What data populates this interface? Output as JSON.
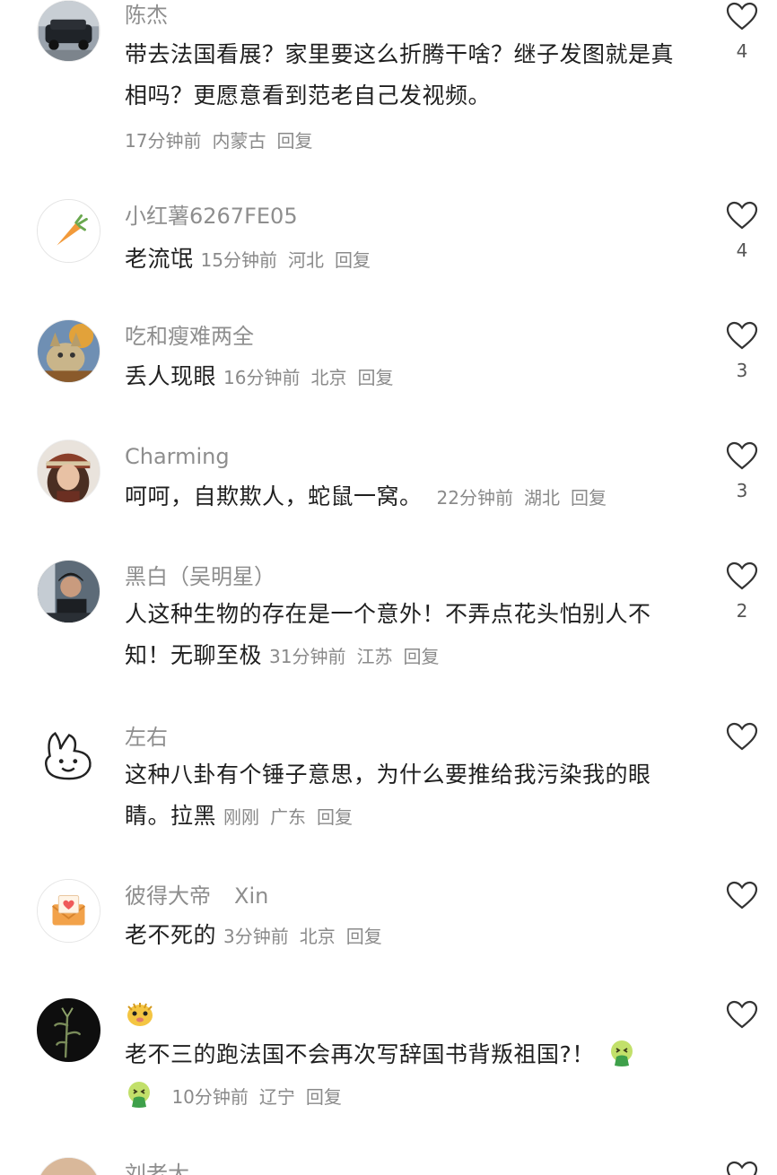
{
  "comments": [
    {
      "author": "陈杰",
      "text": "带去法国看展？家里要这么折腾干啥？继子发图就是真相吗？更愿意看到范老自己发视频。",
      "time": "17分钟前",
      "location": "内蒙古",
      "reply_label": "回复",
      "likes": "4",
      "avatar_icon": "car-photo-avatar"
    },
    {
      "author": "小红薯6267FE05",
      "text": "老流氓",
      "time": "15分钟前",
      "location": "河北",
      "reply_label": "回复",
      "likes": "4",
      "avatar_icon": "carrot-avatar"
    },
    {
      "author": "吃和瘦难两全",
      "text": "丢人现眼",
      "time": "16分钟前",
      "location": "北京",
      "reply_label": "回复",
      "likes": "3",
      "avatar_icon": "cat-photo-avatar"
    },
    {
      "author": "Charming",
      "text": "呵呵，自欺欺人，蛇鼠一窝。",
      "time": "22分钟前",
      "location": "湖北",
      "reply_label": "回复",
      "likes": "3",
      "avatar_icon": "woman-portrait-avatar"
    },
    {
      "author": "黑白（吴明星）",
      "text": "人这种生物的存在是一个意外！不弄点花头怕别人不知！无聊至极",
      "time": "31分钟前",
      "location": "江苏",
      "reply_label": "回复",
      "likes": "2",
      "avatar_icon": "man-photo-avatar"
    },
    {
      "author": "左右",
      "text": "这种八卦有个锤子意思，为什么要推给我污染我的眼睛。拉黑",
      "time": "刚刚",
      "location": "广东",
      "reply_label": "回复",
      "likes": "",
      "avatar_icon": "bunny-doodle-avatar"
    },
    {
      "author": "彼得大帝",
      "author_extra": "Xin",
      "text": "老不死的",
      "time": "3分钟前",
      "location": "北京",
      "reply_label": "回复",
      "likes": "",
      "avatar_icon": "envelope-heart-avatar"
    },
    {
      "author": "",
      "text": "老不三的跑法国不会再次写辞国书背叛祖国?！",
      "time": "10分钟前",
      "location": "辽宁",
      "reply_label": "回复",
      "likes": "",
      "avatar_icon": "bamboo-dark-avatar",
      "author_emoji": "pufferfish-emoji",
      "trailing_emoji": "sick-face-emoji"
    },
    {
      "author": "刘老大",
      "avatar_icon": "partial-avatar"
    }
  ]
}
